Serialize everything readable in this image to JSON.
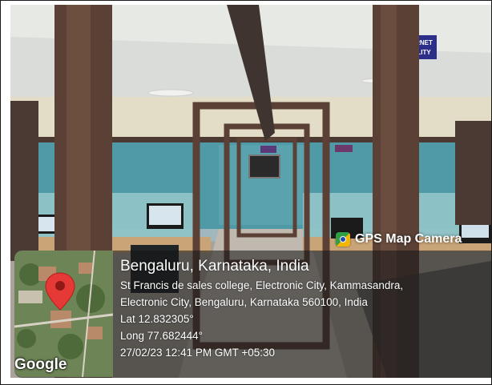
{
  "overlay": {
    "app_name": "GPS Map Camera",
    "location_title": "Bengaluru, Karnataka, India",
    "address_line1": "St Francis de sales college, Electronic City, Kammasandra,",
    "address_line2": "Electronic City, Bengaluru, Karnataka 560100, India",
    "latitude": "Lat 12.832305°",
    "longitude": "Long 77.682444°",
    "datetime": "27/02/23 12:41 PM GMT +05:30",
    "map_logo": "Google"
  },
  "signs": {
    "sign_text": "RNET\nLITY"
  },
  "icons": {
    "app": "camera-map-icon",
    "pin": "location-pin-icon"
  },
  "colors": {
    "wall_teal": "#4f9aa6",
    "pillar_brown": "#5a4035",
    "overlay_bg": "#141414",
    "pin_red": "#e53935"
  }
}
